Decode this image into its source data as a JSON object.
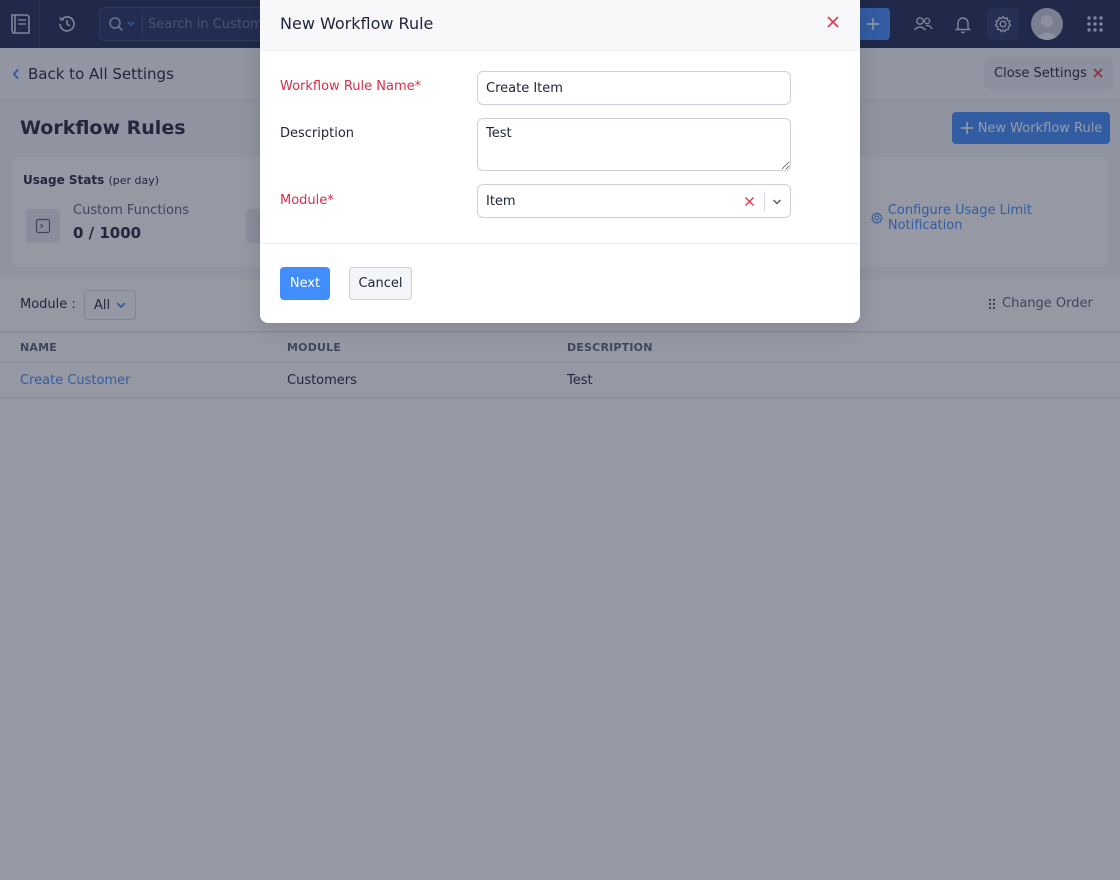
{
  "topbar": {
    "search_placeholder": "Search in Customers",
    "icons": [
      "book-logo-icon",
      "history-icon",
      "search-icon",
      "plus-icon",
      "users-icon",
      "bell-icon",
      "gear-icon",
      "avatar",
      "apps-grid-icon"
    ]
  },
  "subheader": {
    "back_label": "Back to All Settings",
    "close_label": "Close Settings"
  },
  "page": {
    "title": "Workflow Rules",
    "new_rule_label": "New Workflow Rule"
  },
  "usage": {
    "title": "Usage Stats",
    "title_suffix": "(per day)",
    "custom_functions_label": "Custom Functions",
    "custom_functions_value": "0 / 1000",
    "configure_label": "Configure Usage Limit Notification"
  },
  "filter": {
    "module_label": "Module :",
    "module_value": "All",
    "change_order_label": "Change Order"
  },
  "table": {
    "headers": [
      "NAME",
      "MODULE",
      "DESCRIPTION"
    ],
    "rows": [
      {
        "name": "Create Customer",
        "module": "Customers",
        "description": "Test"
      }
    ]
  },
  "modal": {
    "title": "New Workflow Rule",
    "name_label": "Workflow Rule Name*",
    "name_value": "Create Item",
    "description_label": "Description",
    "description_value": "Test",
    "module_label": "Module*",
    "module_value": "Item",
    "next_label": "Next",
    "cancel_label": "Cancel"
  },
  "colors": {
    "topbar_bg": "#1e2951",
    "accent": "#408dfb",
    "required": "#d6304a",
    "close_red": "#e04050"
  }
}
